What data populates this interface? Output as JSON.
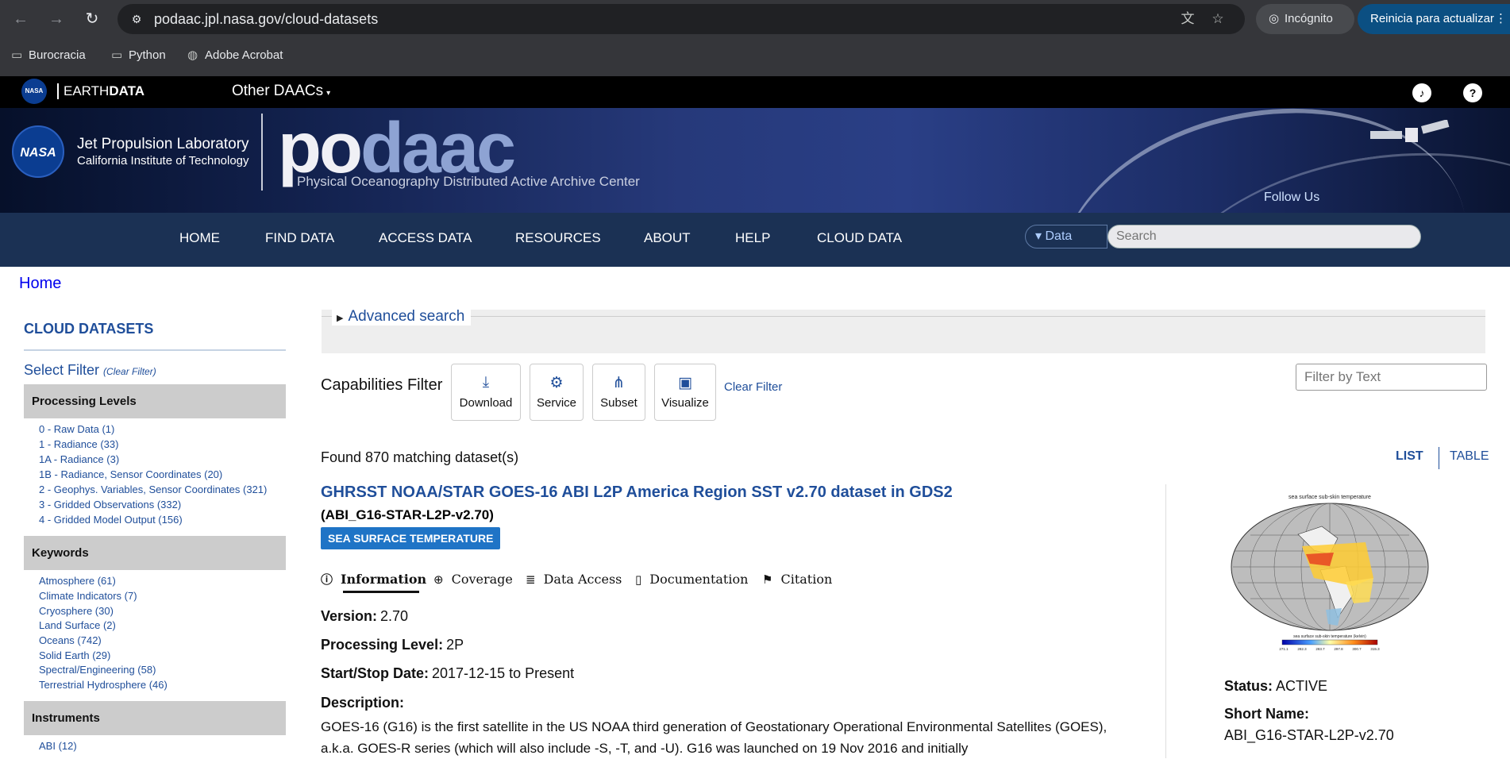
{
  "browser": {
    "url": "podaac.jpl.nasa.gov/cloud-datasets",
    "incognito_label": "Incógnito",
    "update_label": "Reinicia para actualizar",
    "bookmarks": [
      "Burocracia",
      "Python",
      "Adobe Acrobat"
    ]
  },
  "earthdata": {
    "logo_prefix": "EARTH",
    "logo_suffix": "DATA",
    "other_daacs": "Other DAACs"
  },
  "banner": {
    "jpl_title": "Jet Propulsion Laboratory",
    "jpl_subtitle": "California Institute of Technology",
    "logo_text_a": "po",
    "logo_text_b": "daac",
    "logo_subtitle": "Physical Oceanography Distributed Active Archive Center",
    "follow_us": "Follow Us"
  },
  "nav": {
    "items": [
      "HOME",
      "FIND DATA",
      "ACCESS DATA",
      "RESOURCES",
      "ABOUT",
      "HELP",
      "CLOUD DATA"
    ],
    "data_select": "Data",
    "search_placeholder": "Search"
  },
  "breadcrumb": "Home",
  "sidebar": {
    "title": "CLOUD DATASETS",
    "select_filter": "Select Filter",
    "clear_filter": "(Clear Filter)",
    "facets": [
      {
        "title": "Processing Levels",
        "items": [
          "0 - Raw Data (1)",
          "1 - Radiance (33)",
          "1A - Radiance (3)",
          "1B - Radiance, Sensor Coordinates (20)",
          "2 - Geophys. Variables, Sensor Coordinates (321)",
          "3 - Gridded Observations (332)",
          "4 - Gridded Model Output (156)"
        ]
      },
      {
        "title": "Keywords",
        "items": [
          "Atmosphere (61)",
          "Climate Indicators (7)",
          "Cryosphere (30)",
          "Land Surface (2)",
          "Oceans (742)",
          "Solid Earth (29)",
          "Spectral/Engineering (58)",
          "Terrestrial Hydrosphere (46)"
        ]
      },
      {
        "title": "Instruments",
        "items": [
          "ABI (12)"
        ]
      }
    ]
  },
  "main": {
    "advanced_search": "Advanced search",
    "capabilities_label": "Capabilities Filter",
    "capabilities": [
      "Download",
      "Service",
      "Subset",
      "Visualize"
    ],
    "clear_filter": "Clear Filter",
    "filter_placeholder": "Filter by Text",
    "found": "Found 870 matching dataset(s)",
    "view_list": "LIST",
    "view_table": "TABLE"
  },
  "dataset": {
    "title": "GHRSST NOAA/STAR GOES-16 ABI L2P America Region SST v2.70 dataset in GDS2",
    "short_name_paren": "(ABI_G16-STAR-L2P-v2.70)",
    "badge": "SEA SURFACE TEMPERATURE",
    "tabs": [
      "Information",
      "Coverage",
      "Data Access",
      "Documentation",
      "Citation"
    ],
    "version_label": "Version:",
    "version": "2.70",
    "level_label": "Processing Level:",
    "level": "2P",
    "dates_label": "Start/Stop Date:",
    "dates": "2017-12-15 to Present",
    "description_label": "Description:",
    "description": "GOES-16 (G16) is the first satellite in the US NOAA third generation of Geostationary Operational Environmental Satellites (GOES), a.k.a. GOES-R series (which will also include -S, -T, and -U). G16 was launched on 19 Nov 2016 and initially",
    "status_label": "Status:",
    "status": "ACTIVE",
    "short_name_label": "Short Name:",
    "short_name": "ABI_G16-STAR-L2P-v2.70",
    "thumb_title": "sea surface sub-skin temperature",
    "thumb_colorbar_label": "sea surface sub-skin temperature (kelvin)",
    "thumb_ticks": [
      "271.1",
      "282.3",
      "283.7",
      "297.8",
      "300.7",
      "315.3"
    ]
  },
  "colors": {
    "nav_bg": "#1b3154",
    "link": "#1f4e9a",
    "badge": "#1f74c6"
  }
}
